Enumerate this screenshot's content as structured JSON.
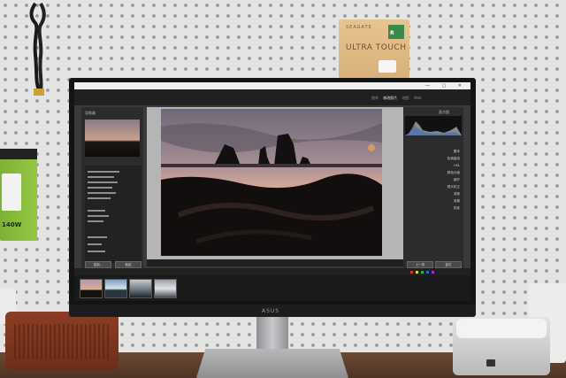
{
  "scene": {
    "charger_label": "140W",
    "drive_box": {
      "brand": "SEAGATE",
      "name": "ULTRA TOUCH",
      "badge": "R"
    },
    "monitor_brand": "ASUS"
  },
  "lightroom": {
    "left_panel_title": "导航器",
    "right_panel_title": "直方图",
    "modules": [
      "图库",
      "修改照片",
      "地图",
      "画册",
      "幻灯片放映",
      "打印",
      "Web"
    ],
    "active_module": "修改照片",
    "right_sections": [
      "基本",
      "色调曲线",
      "HSL",
      "颜色分级",
      "细节",
      "镜头校正",
      "变换",
      "效果",
      "校准"
    ],
    "left_buttons": [
      "复制...",
      "粘贴"
    ],
    "right_buttons": [
      "上一张",
      "复位"
    ],
    "filmstrip_count": 4,
    "colors": {
      "panel": "#2c2c2c",
      "viewer_bg": "#b5b5b5"
    }
  }
}
